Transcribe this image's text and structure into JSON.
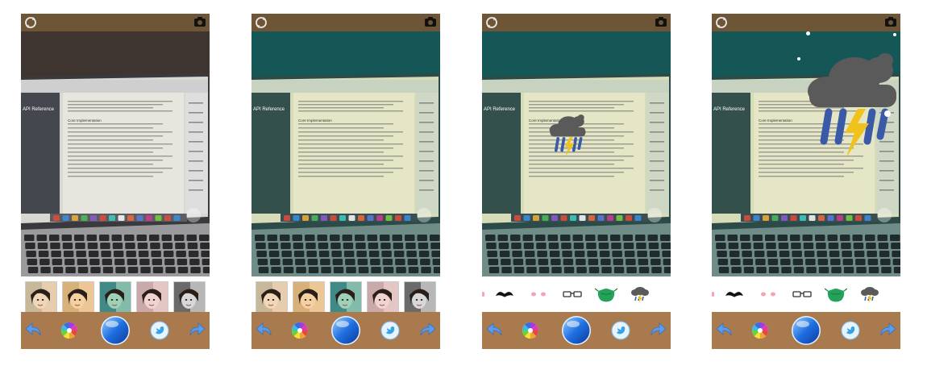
{
  "screens": [
    {
      "id": "screen-1",
      "tint": "original",
      "strip": "filters",
      "overlay": "none"
    },
    {
      "id": "screen-2",
      "tint": "teal",
      "strip": "filters",
      "overlay": "none"
    },
    {
      "id": "screen-3",
      "tint": "teal",
      "strip": "stickers",
      "overlay": "storm-cloud-small"
    },
    {
      "id": "screen-4",
      "tint": "teal",
      "strip": "stickers",
      "overlay": "storm-cloud-large"
    }
  ],
  "laptop_screen": {
    "sidebar_title": "API Reference",
    "section_title": "Core Implementation"
  },
  "filters": [
    "original-filter",
    "warm-filter",
    "teal-filter",
    "fade-filter",
    "mono-filter"
  ],
  "stickers": [
    "mustache-icon",
    "blush-icon",
    "glasses-icon",
    "mask-icon",
    "storm-cloud-icon"
  ],
  "toolbar": [
    "undo-icon",
    "color-wheel-icon",
    "shutter-button",
    "twitter-icon",
    "redo-icon"
  ],
  "colors": {
    "topbar": "#6e5535",
    "toolbar": "#a87a4e",
    "teal_tint": "#1f6f70",
    "cloud": "#5a5a5a",
    "lightning": "#f1c21b",
    "rain": "#3a5aa8",
    "mask": "#23a35a"
  }
}
